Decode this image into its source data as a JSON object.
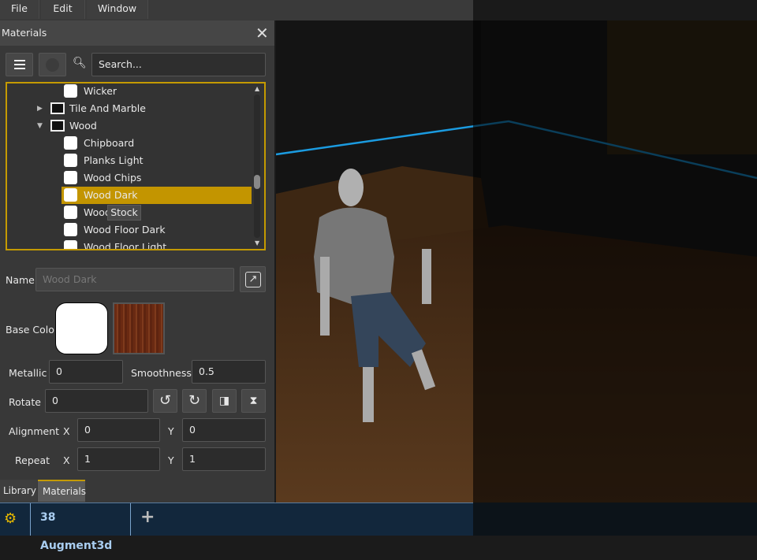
{
  "menu": [
    "File",
    "Edit",
    "Window"
  ],
  "panel": {
    "title": "Materials",
    "search_placeholder": "Search..."
  },
  "tree": [
    {
      "label": "Wicker",
      "type": "material",
      "level": 2
    },
    {
      "label": "Tile And Marble",
      "type": "folder",
      "expanded": false,
      "level": 1
    },
    {
      "label": "Wood",
      "type": "folder",
      "expanded": true,
      "level": 1
    },
    {
      "label": "Chipboard",
      "type": "material",
      "level": 2
    },
    {
      "label": "Planks Light",
      "type": "material",
      "level": 2
    },
    {
      "label": "Wood Chips",
      "type": "material",
      "level": 2
    },
    {
      "label": "Wood Dark",
      "type": "material",
      "level": 2,
      "selected": true
    },
    {
      "label": "Wood",
      "type": "material",
      "level": 2
    },
    {
      "label": "Wood Floor Dark",
      "type": "material",
      "level": 2
    },
    {
      "label": "Wood Floor Light",
      "type": "material",
      "level": 2
    }
  ],
  "tooltip": "Stock",
  "props": {
    "name_label": "Name",
    "name_value": "Wood Dark",
    "base_color_label": "Base Color",
    "metallic_label": "Metallic",
    "metallic": "0",
    "smoothness_label": "Smoothness",
    "smoothness": "0.5",
    "rotate_label": "Rotate",
    "rotate": "0",
    "alignment_label": "Alignment",
    "align_x": "0",
    "align_y": "0",
    "repeat_label": "Repeat",
    "repeat_x": "1",
    "repeat_y": "1",
    "x": "X",
    "y": "Y"
  },
  "tabs": [
    "Library",
    "Materials"
  ],
  "bottom": {
    "tab": "38 Augment3d",
    "add": "+"
  },
  "colors": {
    "accent": "#c39500",
    "tab_text": "#a9cdf0"
  }
}
